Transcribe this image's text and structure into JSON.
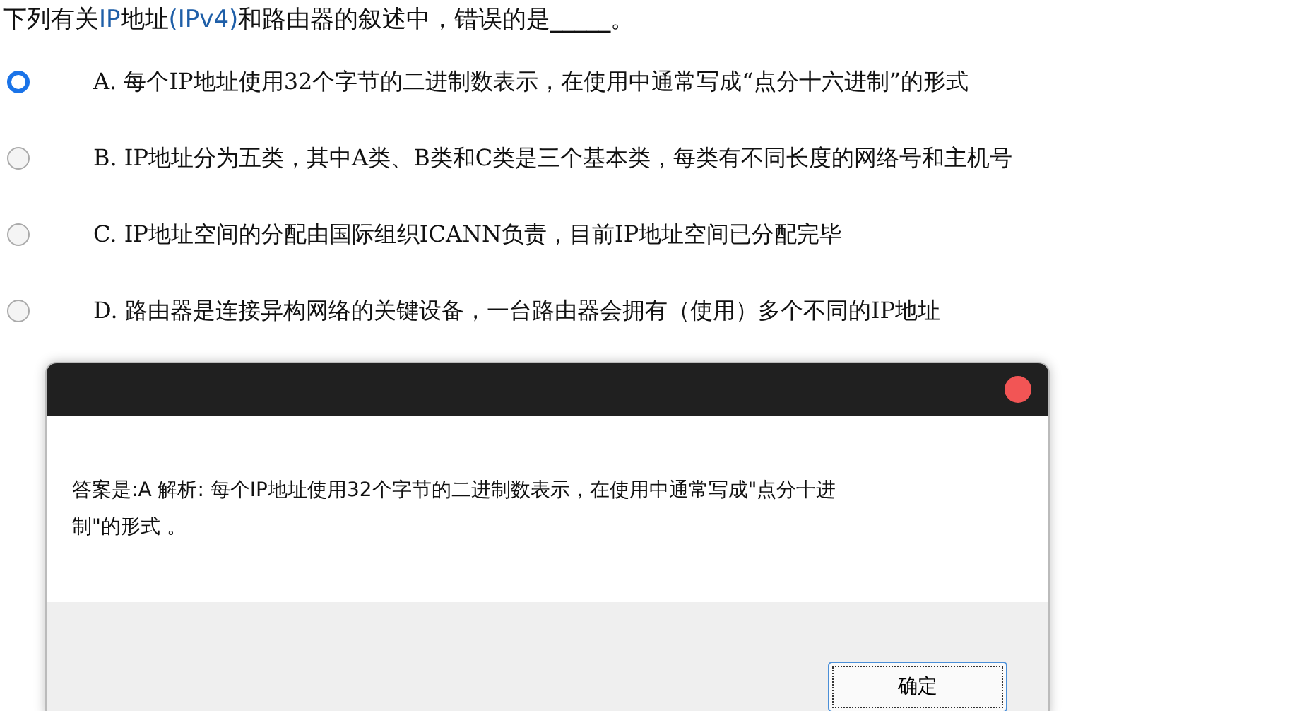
{
  "question": [
    {
      "text": "下列有关",
      "accent": false
    },
    {
      "text": "IP",
      "accent": true
    },
    {
      "text": "地址",
      "accent": false
    },
    {
      "text": "(IPv4)",
      "accent": true
    },
    {
      "text": "和路由器的叙述中，错误的是_____。",
      "accent": false
    }
  ],
  "options": [
    {
      "label": "A. 每个IP地址使用32个字节的二进制数表示，在使用中通常写成“点分十六进制”的形式",
      "selected": true
    },
    {
      "label": "B. IP地址分为五类，其中A类、B类和C类是三个基本类，每类有不同长度的网络号和主机号",
      "selected": false
    },
    {
      "label": "C. IP地址空间的分配由国际组织ICANN负责，目前IP地址空间已分配完毕",
      "selected": false
    },
    {
      "label": "D. 路由器是连接异构网络的关键设备，一台路由器会拥有（使用）多个不同的IP地址",
      "selected": false
    }
  ],
  "dialog": {
    "message": "答案是:A  解析: 每个IP地址使用32个字节的二进制数表示，在使用中通常写成\"点分十进制\"的形式 。",
    "button": "确定"
  }
}
